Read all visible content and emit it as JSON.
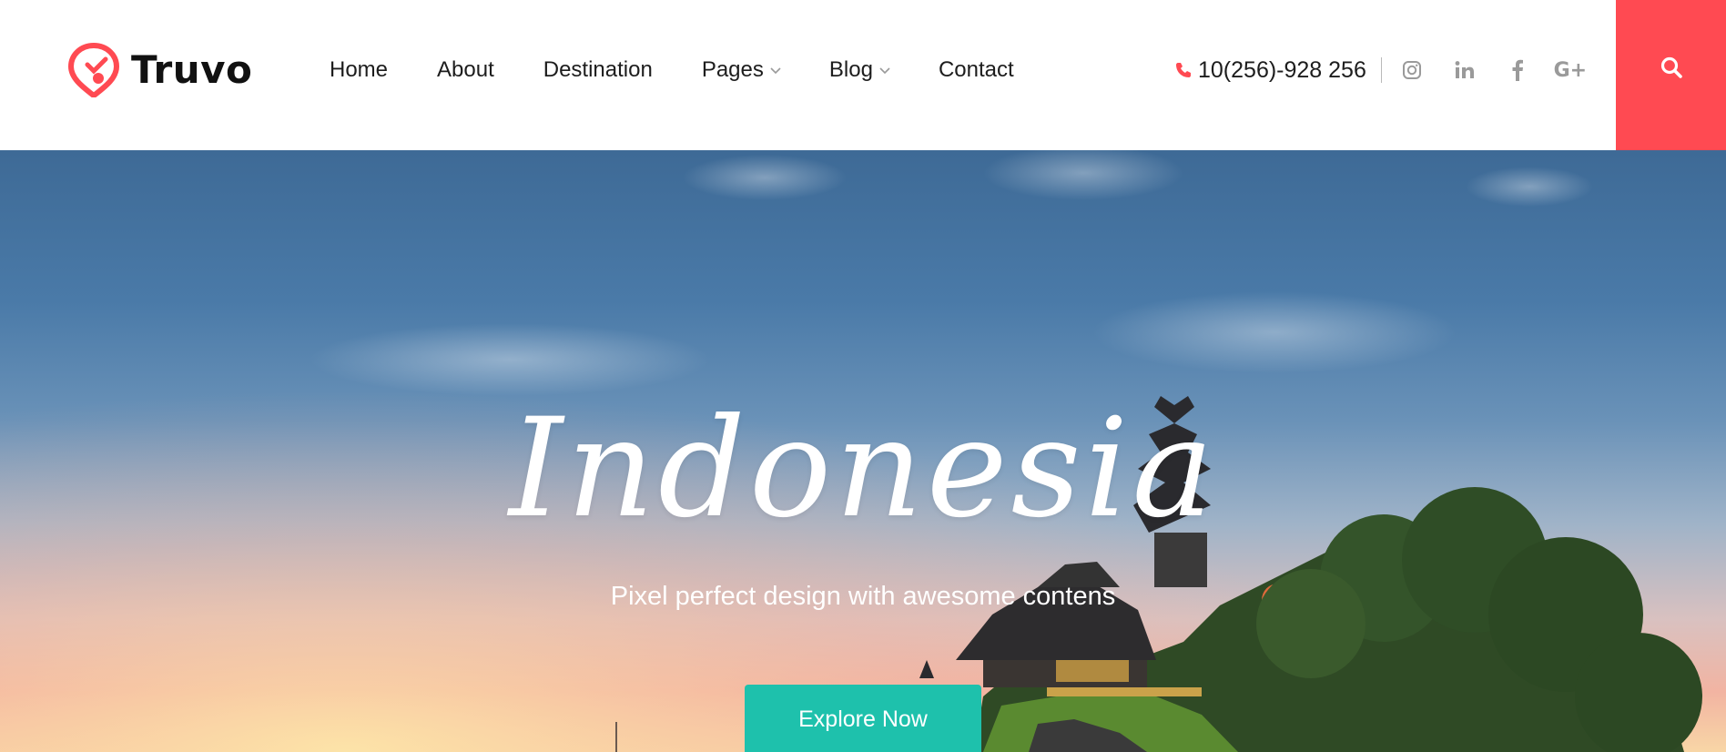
{
  "brand": {
    "name": "Truvo",
    "accent_color": "#ff4a52"
  },
  "nav": {
    "items": [
      {
        "label": "Home",
        "has_dropdown": false
      },
      {
        "label": "About",
        "has_dropdown": false
      },
      {
        "label": "Destination",
        "has_dropdown": false
      },
      {
        "label": "Pages",
        "has_dropdown": true
      },
      {
        "label": "Blog",
        "has_dropdown": true
      },
      {
        "label": "Contact",
        "has_dropdown": false
      }
    ]
  },
  "contact": {
    "phone": "10(256)-928 256",
    "phone_icon": "phone-icon"
  },
  "social": {
    "icons": [
      "instagram-icon",
      "linkedin-icon",
      "facebook-icon",
      "google-plus-icon"
    ],
    "google_plus_label": "G+"
  },
  "search": {
    "icon": "search-icon",
    "background": "#ff4a52"
  },
  "hero": {
    "title": "Indonesia",
    "subtitle": "Pixel perfect design with awesome contens",
    "cta_label": "Explore Now",
    "cta_color": "#1ec1ac"
  }
}
